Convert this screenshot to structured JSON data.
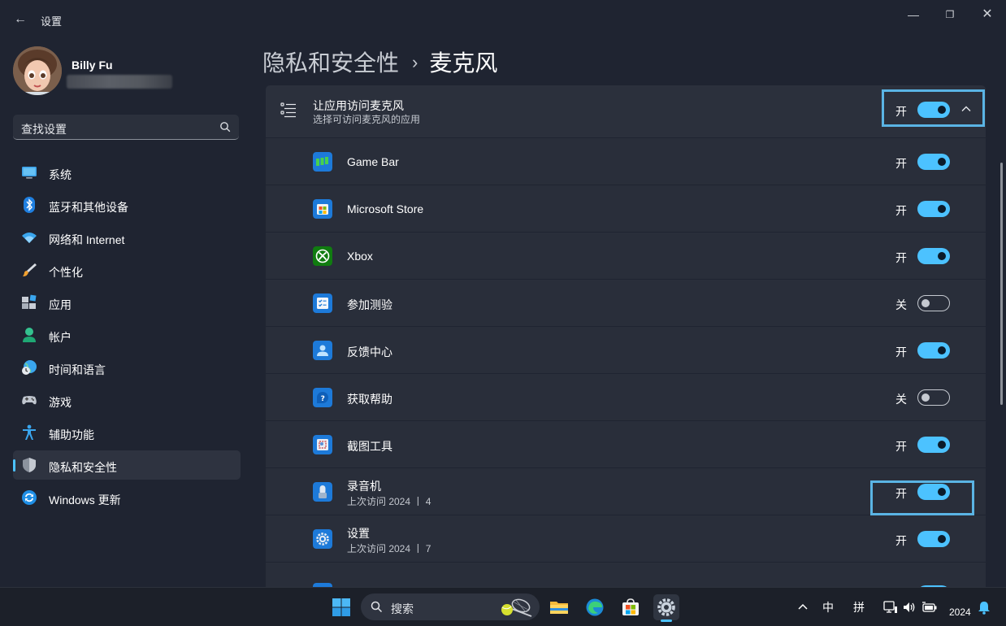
{
  "window": {
    "title": "设置",
    "back_glyph": "←",
    "min_glyph": "—",
    "max_glyph": "❐",
    "close_glyph": "✕"
  },
  "user": {
    "name": "Billy Fu"
  },
  "search": {
    "placeholder": "查找设置"
  },
  "sidebar": {
    "items": [
      {
        "label": "系统",
        "icon": "monitor-icon"
      },
      {
        "label": "蓝牙和其他设备",
        "icon": "bluetooth-icon"
      },
      {
        "label": "网络和 Internet",
        "icon": "wifi-icon"
      },
      {
        "label": "个性化",
        "icon": "paintbrush-icon"
      },
      {
        "label": "应用",
        "icon": "apps-icon"
      },
      {
        "label": "帐户",
        "icon": "person-icon"
      },
      {
        "label": "时间和语言",
        "icon": "globe-clock-icon"
      },
      {
        "label": "游戏",
        "icon": "gamepad-icon"
      },
      {
        "label": "辅助功能",
        "icon": "accessibility-icon"
      },
      {
        "label": "隐私和安全性",
        "icon": "shield-icon",
        "active": true
      },
      {
        "label": "Windows 更新",
        "icon": "update-icon"
      }
    ]
  },
  "breadcrumb": {
    "parent": "隐私和安全性",
    "separator": "›",
    "current": "麦克风"
  },
  "main": {
    "header": {
      "title": "让应用访问麦克风",
      "subtitle": "选择可访问麦克风的应用",
      "state": "开",
      "on": true
    },
    "apps": [
      {
        "name": "Game Bar",
        "state": "开",
        "on": true,
        "icon": "gamebar-icon"
      },
      {
        "name": "Microsoft Store",
        "state": "开",
        "on": true,
        "icon": "store-icon"
      },
      {
        "name": "Xbox",
        "state": "开",
        "on": true,
        "icon": "xbox-icon"
      },
      {
        "name": "参加测验",
        "state": "关",
        "on": false,
        "icon": "quiz-icon"
      },
      {
        "name": "反馈中心",
        "state": "开",
        "on": true,
        "icon": "feedback-hub-icon"
      },
      {
        "name": "获取帮助",
        "state": "关",
        "on": false,
        "icon": "get-help-icon"
      },
      {
        "name": "截图工具",
        "state": "开",
        "on": true,
        "icon": "snipping-tool-icon"
      },
      {
        "name": "录音机",
        "meta": "上次访问 2024 丨 4",
        "state": "开",
        "on": true,
        "icon": "voice-recorder-icon"
      },
      {
        "name": "设置",
        "meta": "上次访问 2024 丨 7",
        "state": "开",
        "on": true,
        "icon": "settings-gear-icon"
      }
    ]
  },
  "taskbar": {
    "search_label": "搜索",
    "tray": {
      "ime_mode": "中",
      "ime_name": "拼",
      "year": "2024"
    }
  },
  "colors": {
    "accent": "#4cc2ff",
    "highlight_box": "#5ab4e4",
    "background": "#1f2431",
    "card": "#292e3a"
  }
}
